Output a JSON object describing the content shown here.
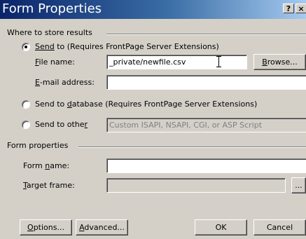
{
  "window": {
    "title": "Form Properties",
    "help_label": "?",
    "close_label": "×"
  },
  "store": {
    "group_label": "Where to store results",
    "send_to_file": {
      "prefix": "Send",
      "suffix": " to (Requires FrontPage Server Extensions)",
      "selected": true
    },
    "file_name": {
      "label_key": "F",
      "label_rest": "ile name:",
      "value": "_private/newfile.csv",
      "browse": "Browse..."
    },
    "email": {
      "label_key": "E",
      "label_rest": "-mail address:",
      "value": ""
    },
    "send_to_database": {
      "before": "Send to ",
      "key": "d",
      "after": "atabase (Requires FrontPage Server Extensions)",
      "selected": false
    },
    "send_to_other": {
      "before": "Send to othe",
      "key": "r",
      "after": "",
      "selected": false,
      "option": "Custom ISAPI, NSAPI, CGI, or ASP Script"
    }
  },
  "form_properties": {
    "group_label": "Form properties",
    "form_name": {
      "before": "Form ",
      "key": "n",
      "after": "ame:",
      "value": ""
    },
    "target_frame": {
      "key": "T",
      "after": "arget frame:",
      "value": "",
      "button": "..."
    }
  },
  "buttons": {
    "options": {
      "key": "O",
      "after": "ptions..."
    },
    "advanced": {
      "key": "A",
      "after": "dvanced..."
    },
    "ok": "OK",
    "cancel": "Cancel"
  }
}
